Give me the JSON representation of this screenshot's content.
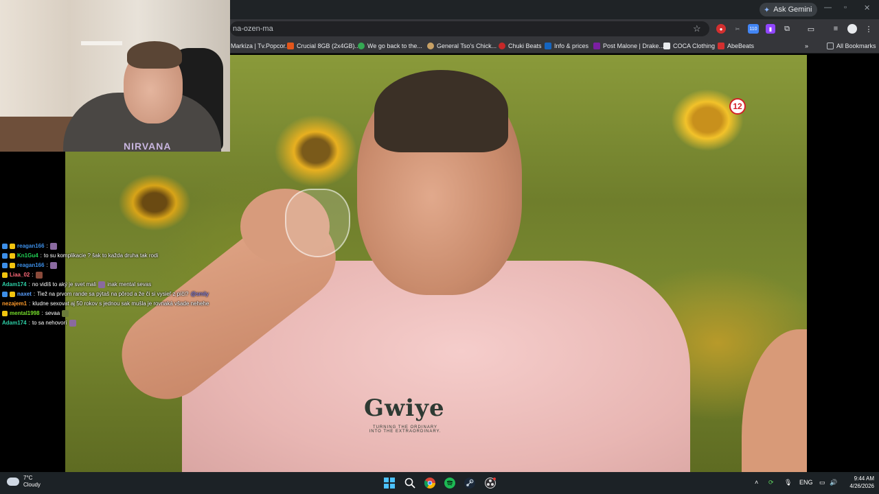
{
  "browser": {
    "ask_gemini": "Ask Gemini",
    "url": "na-ozen-ma",
    "extension_badge": "110",
    "bookmarks": [
      {
        "label": "Markíza | Tv.Popcor...",
        "color": "#5f6368"
      },
      {
        "label": "Crucial 8GB (2x4GB)...",
        "color": "#e3561b"
      },
      {
        "label": "We go back to the...",
        "color": "#34a853"
      },
      {
        "label": "General Tso's Chick...",
        "color": "#c8a165"
      },
      {
        "label": "Chuki Beats",
        "color": "#c62828"
      },
      {
        "label": "Info & prices",
        "color": "#1565c0"
      },
      {
        "label": "Post Malone | Drake...",
        "color": "#7b1fa2"
      },
      {
        "label": "COCA Clothing",
        "color": "#212121"
      },
      {
        "label": "AbeBeats",
        "color": "#d32f2f"
      }
    ],
    "all_bookmarks": "All Bookmarks"
  },
  "video": {
    "channel_logo": "12",
    "shirt_logo": "Gwiye",
    "shirt_tagline": "TURNING THE ORDINARY INTO THE EXTRAORDINARY."
  },
  "webcam": {
    "shirt_print": "NIRVANA"
  },
  "chat": [
    {
      "user": "reagan166",
      "user_color": "#3d8fe8",
      "text": "",
      "emote": true
    },
    {
      "user": "Kn1Gu4",
      "user_color": "#21d356",
      "text": "to su komplikacie ? šak to každa druha tak rodi",
      "emote": false
    },
    {
      "user": "reagan166",
      "user_color": "#3d8fe8",
      "text": "",
      "emote": true
    },
    {
      "user": "Liaa_02",
      "user_color": "#ff6a7a",
      "text": "",
      "emote": true
    },
    {
      "user": "Adam174",
      "user_color": "#2ed1a8",
      "text": "no vidíš to aký je svet mali",
      "emote": true,
      "after": "inak mental sevas"
    },
    {
      "user": "naxet",
      "user_color": "#5aa0ff",
      "text": "Tiež na prvom rande sa pýtaš na pôrod a že či si vysieľ z píči?",
      "emote": false,
      "after": "@smily"
    },
    {
      "user": "nezajem1",
      "user_color": "#ff9b2b",
      "text": "kludne sexovat aj 50 rokov s jednou sak mušla je rovnaká všade nehehe",
      "emote": false
    },
    {
      "user": "mental1998",
      "user_color": "#77e02b",
      "text": "sevaa",
      "emote": true
    },
    {
      "user": "Adam174",
      "user_color": "#2ed1a8",
      "text": "to sa nehovorí",
      "emote": true
    }
  ],
  "taskbar": {
    "temperature": "7°C",
    "condition": "Cloudy",
    "language": "ENG",
    "time": "9:44 AM",
    "date": "4/26/2026"
  }
}
